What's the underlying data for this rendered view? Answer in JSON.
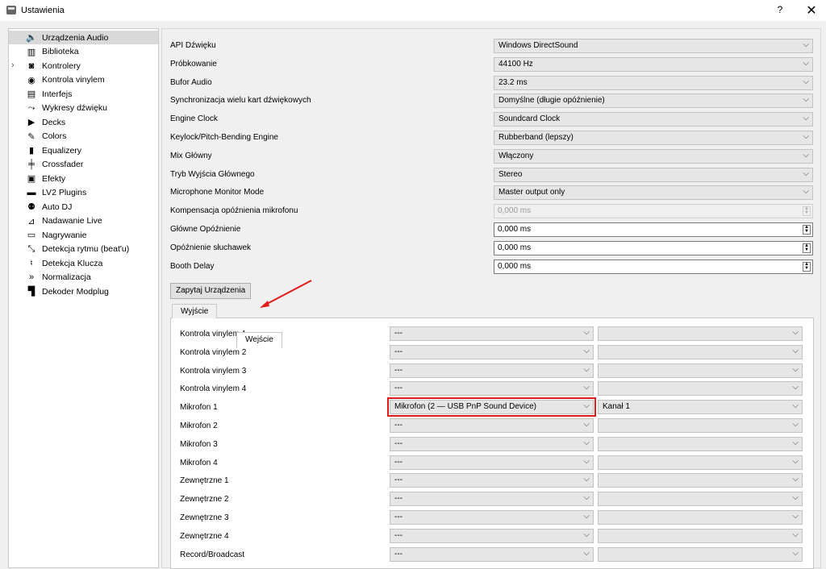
{
  "window": {
    "title": "Ustawienia",
    "help_glyph": "?",
    "close_glyph": "✕"
  },
  "sidebar": {
    "items": [
      {
        "label": "Urządzenia Audio",
        "icon": "speaker-icon",
        "glyph": "🔈",
        "selected": true
      },
      {
        "label": "Biblioteka",
        "icon": "library-icon",
        "glyph": "▥"
      },
      {
        "label": "Kontrolery",
        "icon": "controller-icon",
        "glyph": "◙"
      },
      {
        "label": "Kontrola vinylem",
        "icon": "vinyl-icon",
        "glyph": "◉"
      },
      {
        "label": "Interfejs",
        "icon": "interface-icon",
        "glyph": "▤"
      },
      {
        "label": "Wykresy dźwięku",
        "icon": "waveform-icon",
        "glyph": "⤳"
      },
      {
        "label": "Decks",
        "icon": "play-icon",
        "glyph": "▶"
      },
      {
        "label": "Colors",
        "icon": "palette-icon",
        "glyph": "✎"
      },
      {
        "label": "Equalizery",
        "icon": "equalizer-icon",
        "glyph": "▮"
      },
      {
        "label": "Crossfader",
        "icon": "crossfader-icon",
        "glyph": "╪"
      },
      {
        "label": "Efekty",
        "icon": "effects-icon",
        "glyph": "▣"
      },
      {
        "label": "LV2 Plugins",
        "icon": "lv2-icon",
        "glyph": "▬"
      },
      {
        "label": "Auto DJ",
        "icon": "autodj-icon",
        "glyph": "⚉"
      },
      {
        "label": "Nadawanie Live",
        "icon": "broadcast-icon",
        "glyph": "⊿"
      },
      {
        "label": "Nagrywanie",
        "icon": "recording-icon",
        "glyph": "▭"
      },
      {
        "label": "Detekcja rytmu (beat'u)",
        "icon": "beat-detection-icon",
        "glyph": "⤡"
      },
      {
        "label": "Detekcja Klucza",
        "icon": "key-detection-icon",
        "glyph": "♮"
      },
      {
        "label": "Normalizacja",
        "icon": "normalization-icon",
        "glyph": "»"
      },
      {
        "label": "Dekoder Modplug",
        "icon": "modplug-icon",
        "glyph": "▜"
      }
    ]
  },
  "settings": [
    {
      "label": "API Dźwięku",
      "type": "combo",
      "value": "Windows DirectSound"
    },
    {
      "label": "Próbkowanie",
      "type": "combo",
      "value": "44100 Hz"
    },
    {
      "label": "Bufor Audio",
      "type": "combo",
      "value": "23.2 ms"
    },
    {
      "label": "Synchronizacja wielu kart dźwiękowych",
      "type": "combo",
      "value": "Domyślne (długie opóźnienie)"
    },
    {
      "label": "Engine Clock",
      "type": "combo",
      "value": "Soundcard Clock"
    },
    {
      "label": "Keylock/Pitch-Bending Engine",
      "type": "combo",
      "value": "Rubberband (lepszy)"
    },
    {
      "label": "Mix Główny",
      "type": "combo",
      "value": "Włączony"
    },
    {
      "label": "Tryb Wyjścia Głównego",
      "type": "combo",
      "value": "Stereo"
    },
    {
      "label": "Microphone Monitor Mode",
      "type": "combo",
      "value": "Master output only"
    },
    {
      "label": "Kompensacja opóźnienia mikrofonu",
      "type": "spin",
      "value": "0,000 ms",
      "disabled": true
    },
    {
      "label": "Główne Opóźnienie",
      "type": "spin",
      "value": "0,000 ms"
    },
    {
      "label": "Opóźnienie słuchawek",
      "type": "spin",
      "value": "0,000 ms"
    },
    {
      "label": "Booth Delay",
      "type": "spin",
      "value": "0,000 ms"
    }
  ],
  "query_button": "Zapytaj Urządzenia",
  "tabs": [
    {
      "label": "Wyjście",
      "active": false
    },
    {
      "label": "Wejście",
      "active": true
    }
  ],
  "inputs": [
    {
      "label": "Kontrola vinylem 1",
      "device": "---",
      "channel": ""
    },
    {
      "label": "Kontrola vinylem 2",
      "device": "---",
      "channel": ""
    },
    {
      "label": "Kontrola vinylem 3",
      "device": "---",
      "channel": ""
    },
    {
      "label": "Kontrola vinylem 4",
      "device": "---",
      "channel": ""
    },
    {
      "label": "Mikrofon 1",
      "device": "Mikrofon (2 — USB PnP Sound Device)",
      "channel": "Kanał 1",
      "highlighted": true
    },
    {
      "label": "Mikrofon 2",
      "device": "---",
      "channel": ""
    },
    {
      "label": "Mikrofon 3",
      "device": "---",
      "channel": ""
    },
    {
      "label": "Mikrofon 4",
      "device": "---",
      "channel": ""
    },
    {
      "label": "Zewnętrzne 1",
      "device": "---",
      "channel": ""
    },
    {
      "label": "Zewnętrzne 2",
      "device": "---",
      "channel": ""
    },
    {
      "label": "Zewnętrzne 3",
      "device": "---",
      "channel": ""
    },
    {
      "label": "Zewnętrzne 4",
      "device": "---",
      "channel": ""
    },
    {
      "label": "Record/Broadcast",
      "device": "---",
      "channel": ""
    }
  ],
  "glyphs": {
    "dropdown": "⌵",
    "spin_up": "▲",
    "spin_down": "▼",
    "expander": "›"
  },
  "colors": {
    "annotation": "#e31a1a",
    "selected_bg": "#d9d9d9"
  }
}
